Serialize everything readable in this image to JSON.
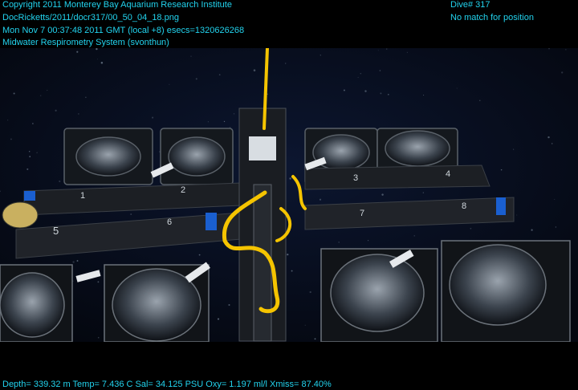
{
  "overlay": {
    "line1": "Copyright 2011 Monterey Bay Aquarium Research Institute",
    "line2": "DocRicketts/2011/docr317/00_50_04_18.png",
    "line3": "Mon Nov  7 00:37:48 2011 GMT (local +8)  esecs=1320626268",
    "line4": "Midwater Respirometry System (svonthun)",
    "dive": "Dive# 317",
    "position": "No match for position",
    "bottom": "Depth= 339.32 m  Temp= 7.436 C  Sal= 34.125 PSU  Oxy= 1.197 ml/l  Xmiss= 87.40%"
  },
  "chamber_numbers": [
    "1",
    "2",
    "3",
    "4",
    "5",
    "6",
    "7",
    "8"
  ],
  "colors": {
    "overlay_text": "#22d3ee",
    "rope": "#f5c400",
    "frame": "#1c1f24",
    "accent_blue": "#1a5fd0",
    "water": "#060c1c"
  }
}
